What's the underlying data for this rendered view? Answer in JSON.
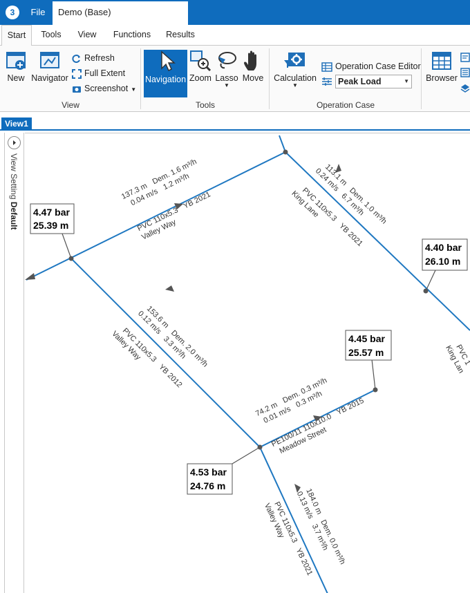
{
  "app": {
    "logo": "3",
    "file_menu": "File",
    "document_title": "Demo (Base)"
  },
  "ribbon_tabs": [
    "Start",
    "Tools",
    "View",
    "Functions",
    "Results"
  ],
  "ribbon": {
    "view_group": {
      "label": "View",
      "new": "New",
      "navigator": "Navigator",
      "refresh": "Refresh",
      "full_extent": "Full Extent",
      "screenshot": "Screenshot"
    },
    "tools_group": {
      "label": "Tools",
      "navigation": "Navigation",
      "zoom": "Zoom",
      "lasso": "Lasso",
      "move": "Move"
    },
    "operation_case_group": {
      "label": "Operation Case",
      "calculation": "Calculation",
      "operation_case_editor": "Operation Case Editor",
      "selected_case": "Peak Load"
    },
    "browser": "Browser"
  },
  "view": {
    "tab_label": "View1",
    "side_setting_label": "View Setting",
    "side_setting_value": "Default"
  },
  "network": {
    "pipes": [
      {
        "id": "p1",
        "length": "137.3 m",
        "demand": "Dem. 1.6 m³/h",
        "velocity": "0.04 m/s",
        "flow": "1.2 m³/h",
        "spec": "PVC 110x5.3",
        "year": "YB 2021",
        "street": "Valley Way"
      },
      {
        "id": "p2",
        "length": "113.1 m",
        "demand": "Dem. 1.0 m³/h",
        "velocity": "0.24 m/s",
        "flow": "6.7 m³/h",
        "spec": "PVC 110x5.3",
        "year": "YB 2021",
        "street": "King Lane"
      },
      {
        "id": "p3",
        "length": "153.6 m",
        "demand": "Dem. 2.0 m³/h",
        "velocity": "0.12 m/s",
        "flow": "3.3 m³/h",
        "spec": "PVC 110x5.3",
        "year": "YB 2012",
        "street": "Valley Way"
      },
      {
        "id": "p4",
        "length": "74.2 m",
        "demand": "Dem. 0.3 m³/h",
        "velocity": "0.01 m/s",
        "flow": "0.3 m³/h",
        "spec": "PE100/11 110x10.0",
        "year": "YB 2015",
        "street": "Meadow Street"
      },
      {
        "id": "p5",
        "length": "184.0 m",
        "demand": "Dem. 0.0 m³/h",
        "velocity": "0.13 m/s",
        "flow": "3.7 m³/h",
        "spec": "PVC 110x5.3",
        "year": "YB 2021",
        "street": "Valley Way"
      },
      {
        "id": "p6",
        "spec": "PVC 1",
        "street": "King Lan"
      }
    ],
    "nodes": [
      {
        "id": "n1",
        "pressure": "4.47 bar",
        "head": "25.39 m"
      },
      {
        "id": "n2",
        "pressure": "4.40 bar",
        "head": "26.10 m"
      },
      {
        "id": "n3",
        "pressure": "4.45 bar",
        "head": "25.57 m"
      },
      {
        "id": "n4",
        "pressure": "4.53 bar",
        "head": "24.76 m"
      }
    ]
  },
  "colors": {
    "accent": "#0f6cbd",
    "pipe": "#1f78c1",
    "arrow": "#555555",
    "node": "#555555"
  }
}
